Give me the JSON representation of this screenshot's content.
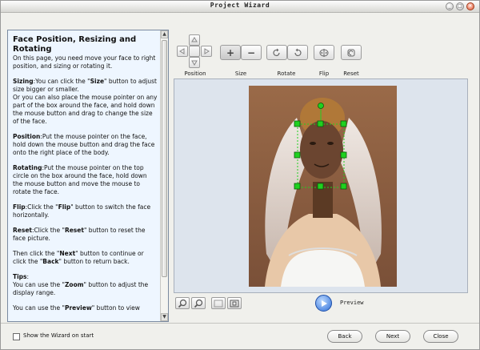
{
  "window": {
    "title": "Project Wizard",
    "minimize_glyph": "_",
    "maximize_glyph": "□",
    "close_glyph": "×"
  },
  "help": {
    "title": "Face Position, Resizing and Rotating",
    "intro": "On this page, you need move your face to right position, and sizing or rotating it.",
    "sizing_head": "Sizing",
    "sizing_1a": ":You can click the \"",
    "sizing_size": "Size",
    "sizing_1b": "\" button to adjust size bigger or smaller.",
    "sizing_2": "Or you can also place the mouse pointer on any part of the box around the face, and hold down the mouse button and drag to change the size of the face.",
    "position_head": "Position",
    "position_text": ":Put the mouse pointer on the face, hold down the mouse button and drag the face onto the right place of the body.",
    "rotating_head": "Rotating",
    "rotating_text": ":Put the mouse pointer on the top circle on the box around the face, hold down the mouse button and move the mouse to rotate the face.",
    "flip_head": "Flip",
    "flip_a": ":Click the \"",
    "flip_key": "Flip",
    "flip_b": "\" button to switch the face horizontally.",
    "reset_head": "Reset",
    "reset_a": ":Click the \"",
    "reset_key": "Reset",
    "reset_b": "\" button to reset the face picture.",
    "then_a": "Then click the \"",
    "then_next": "Next",
    "then_b": "\" button to continue or click the \"",
    "then_back": "Back",
    "then_c": "\" button to return back.",
    "tips_head": "Tips",
    "tips_colon": ":",
    "tips_1a": "You can use the \"",
    "tips_zoom": "Zoom",
    "tips_1b": "\" button to adjust the display range.",
    "tips_2a": "You can use the \"",
    "tips_preview": "Preview",
    "tips_2b": "\" button to view"
  },
  "toolbar": {
    "position_label": "Position",
    "size_label": "Size",
    "rotate_label": "Rotate",
    "flip_label": "Flip",
    "reset_label": "Reset",
    "size_plus": "+",
    "size_minus": "−"
  },
  "preview_label": "Preview",
  "footer": {
    "show_wizard_label": "Show the Wizard on start",
    "show_wizard_checked": false,
    "back_label": "Back",
    "next_label": "Next",
    "close_label": "Close"
  },
  "colors": {
    "handle_green": "#1fd11f",
    "panel_bg": "#eef6ff",
    "canvas_bg": "#dde4ed"
  }
}
